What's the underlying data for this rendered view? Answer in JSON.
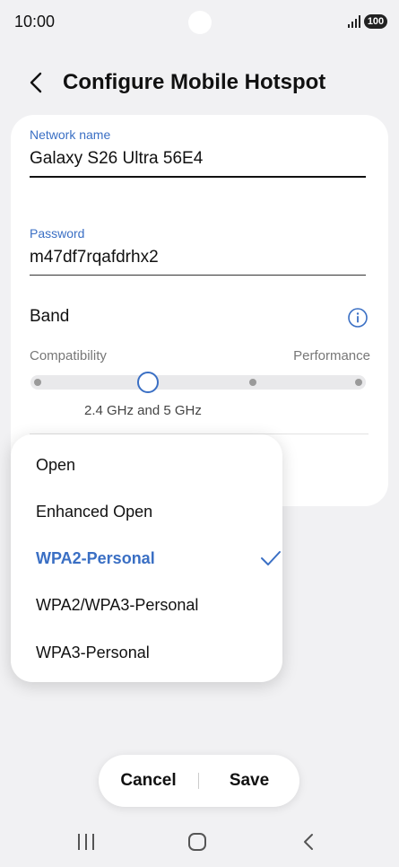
{
  "status_bar": {
    "time": "10:00",
    "battery": "100"
  },
  "header": {
    "title": "Configure Mobile Hotspot"
  },
  "form": {
    "network_name": {
      "label": "Network name",
      "value": "Galaxy S26 Ultra 56E4"
    },
    "password": {
      "label": "Password",
      "value": "m47df7rqafdrhx2"
    },
    "band": {
      "label": "Band",
      "left_label": "Compatibility",
      "right_label": "Performance",
      "selected_value": "2.4 GHz and 5 GHz",
      "selected_level": 0.35
    }
  },
  "security_dropdown": {
    "options": [
      {
        "label": "Open"
      },
      {
        "label": "Enhanced Open"
      },
      {
        "label": "WPA2-Personal"
      },
      {
        "label": "WPA2/WPA3-Personal"
      },
      {
        "label": "WPA3-Personal"
      }
    ],
    "selected": "WPA2-Personal"
  },
  "actions": {
    "cancel": "Cancel",
    "save": "Save"
  },
  "colors": {
    "accent": "#3a6fc4",
    "background": "#f1f1f3",
    "card": "#ffffff"
  },
  "icons": {
    "back": "back-arrow-icon",
    "info": "info-icon",
    "check": "check-icon",
    "signal": "signal-icon"
  }
}
